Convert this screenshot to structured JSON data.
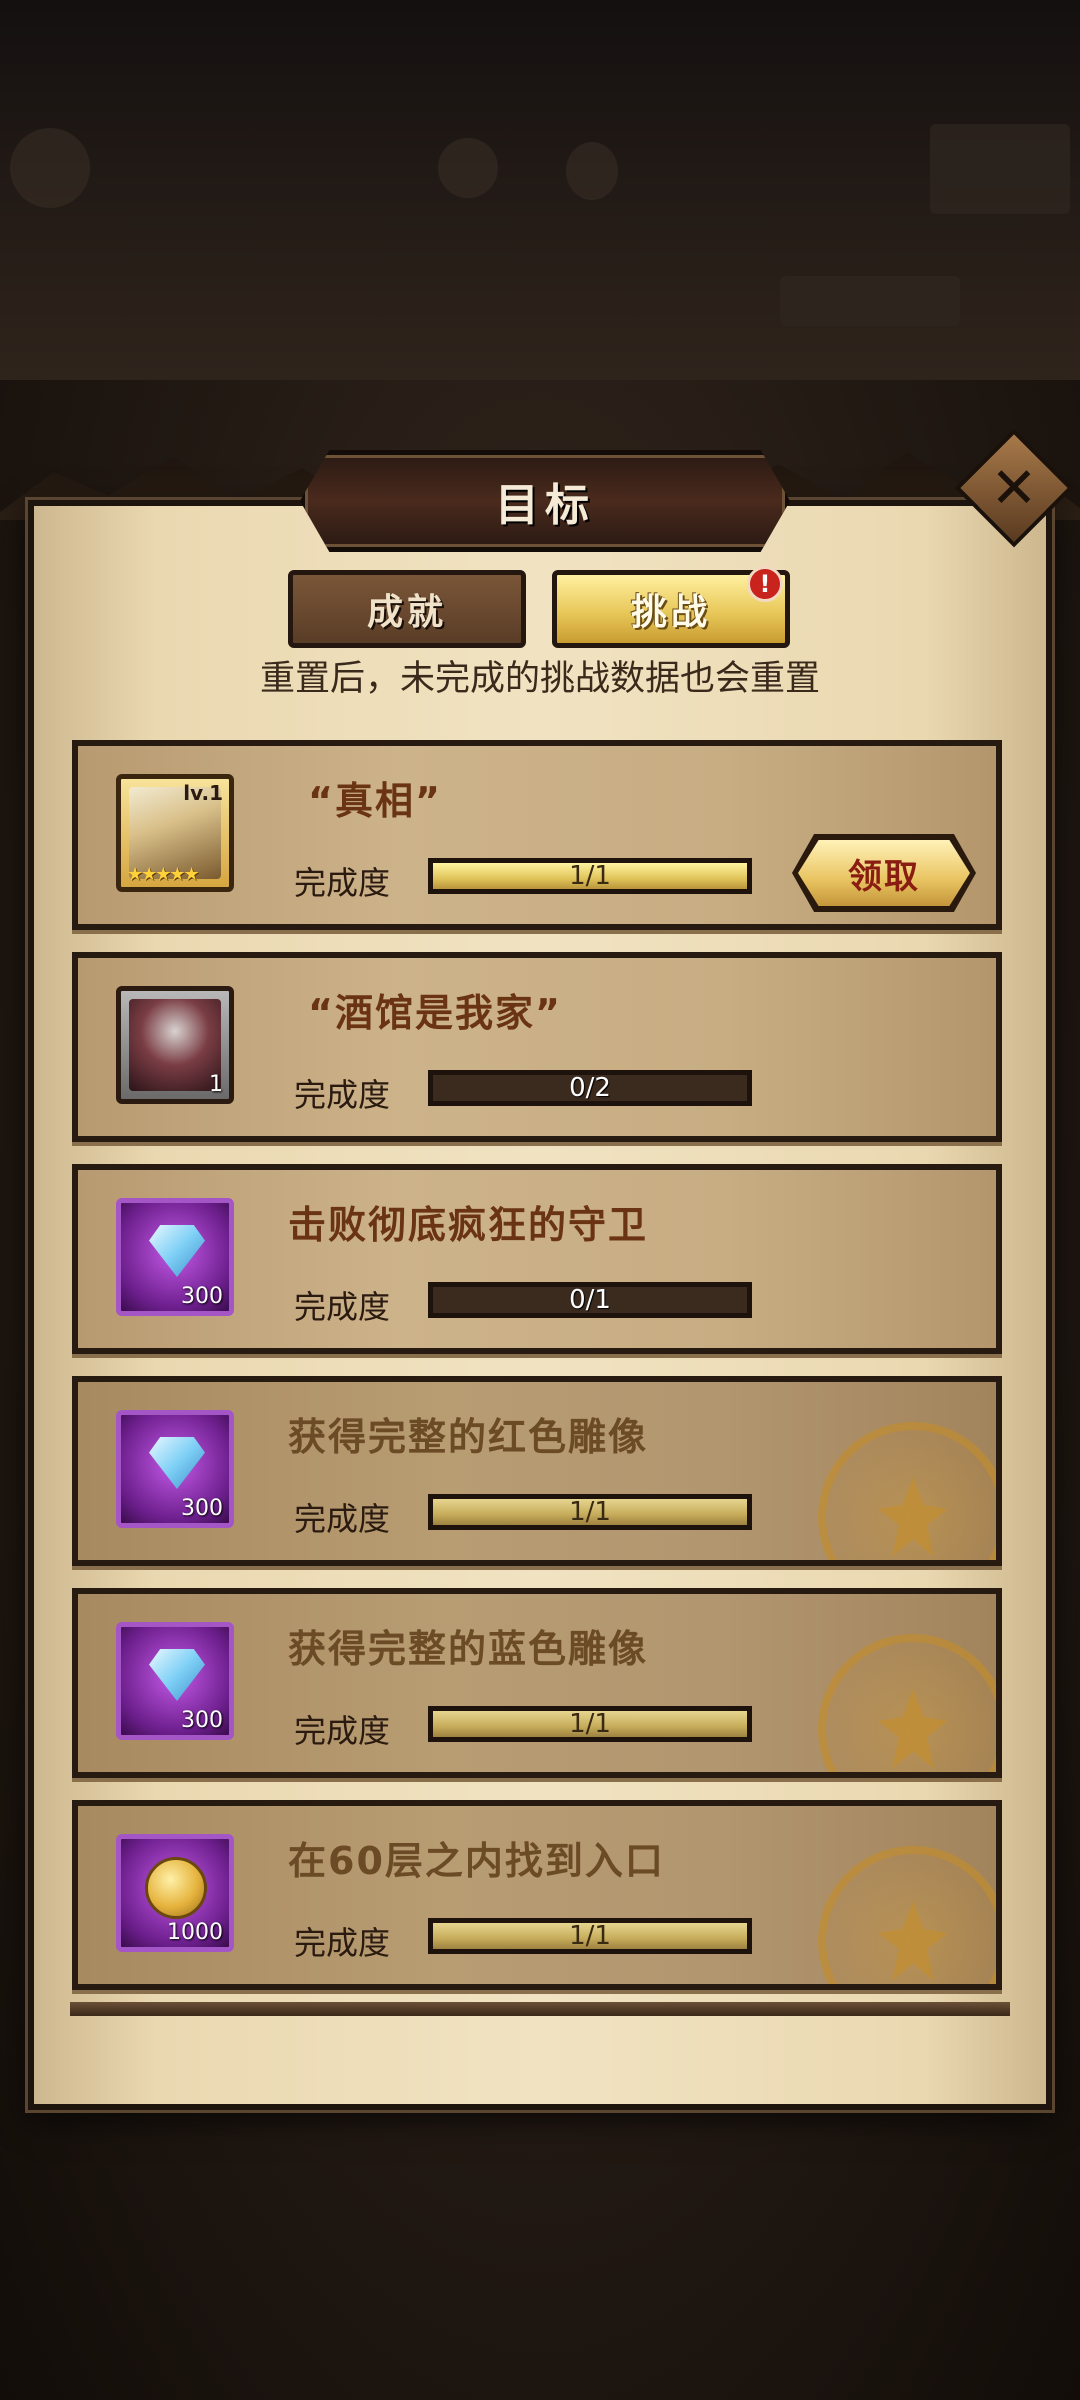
{
  "dialog": {
    "title": "目标",
    "close_icon": "✕",
    "tabs": [
      {
        "label": "成就",
        "active": false
      },
      {
        "label": "挑战",
        "active": true,
        "badge": "!"
      }
    ],
    "notice": "重置后，未完成的挑战数据也会重置",
    "progress_label": "完成度",
    "claim_label": "领取"
  },
  "challenges": [
    {
      "title": "“真相”",
      "reward_icon": "hero-portrait-icon",
      "level": "lv.1",
      "stars": "★★★★★",
      "progress": "1/1",
      "fraction": 1.0,
      "state": "claimable"
    },
    {
      "title": "“酒馆是我家”",
      "reward_icon": "hero-portrait-icon",
      "quantity": "1",
      "progress": "0/2",
      "fraction": 0.0,
      "state": "in-progress"
    },
    {
      "title": "击败彻底疯狂的守卫",
      "reward_icon": "diamond-icon",
      "quantity": "300",
      "progress": "0/1",
      "fraction": 0.0,
      "state": "in-progress"
    },
    {
      "title": "获得完整的红色雕像",
      "reward_icon": "diamond-icon",
      "quantity": "300",
      "progress": "1/1",
      "fraction": 1.0,
      "state": "completed"
    },
    {
      "title": "获得完整的蓝色雕像",
      "reward_icon": "diamond-icon",
      "quantity": "300",
      "progress": "1/1",
      "fraction": 1.0,
      "state": "completed"
    },
    {
      "title": "在60层之内找到入口",
      "reward_icon": "gold-coin-icon",
      "quantity": "1000",
      "progress": "1/1",
      "fraction": 1.0,
      "state": "completed"
    }
  ],
  "colors": {
    "accent_gold": "#e8c85a",
    "badge_red": "#c8231c",
    "title_brown": "#6a3412"
  }
}
